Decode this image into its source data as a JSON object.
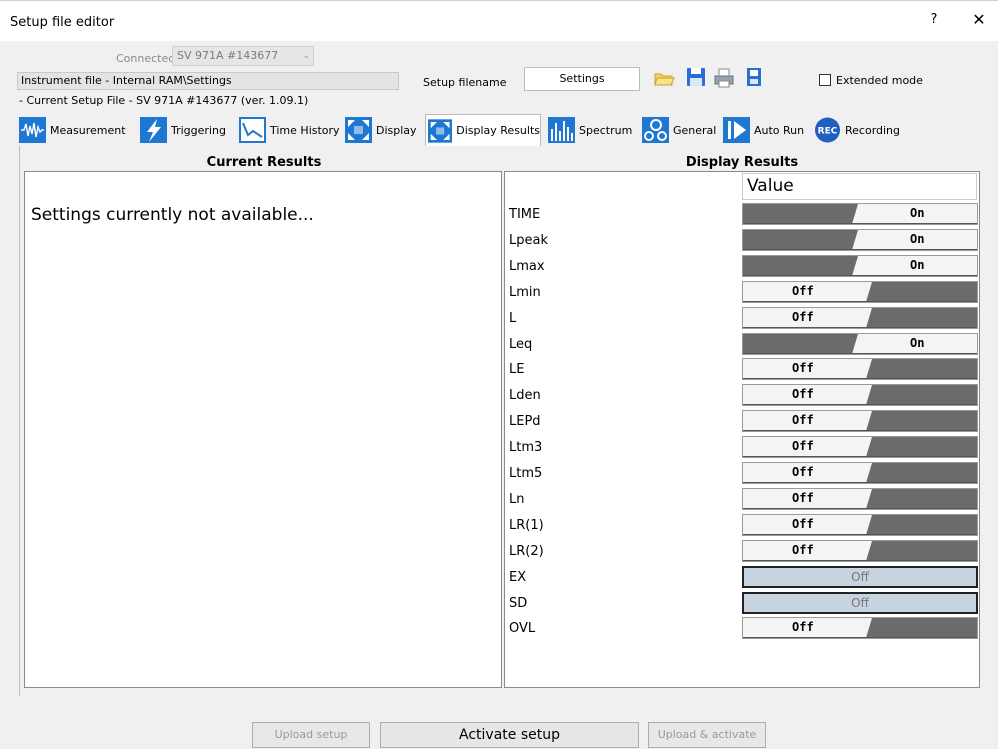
{
  "window": {
    "title": "Setup file editor",
    "help_label": "?",
    "close_label": "✕"
  },
  "header": {
    "connected_label": "Connected",
    "connected_value": "SV 971A #143677",
    "instrument_file": "Instrument file - Internal RAM\\Settings",
    "current_setup": "- Current Setup File  - SV 971A #143677 (ver. 1.09.1)",
    "setup_filename_label": "Setup filename",
    "setup_filename_value": "Settings",
    "extended_mode_label": "Extended mode",
    "extended_mode_checked": false,
    "tool_icons": [
      "open-folder-icon",
      "save-icon",
      "print-icon",
      "save-as-icon"
    ]
  },
  "tabs": [
    {
      "label": "Measurement",
      "icon": "waveform-icon",
      "active": false
    },
    {
      "label": "Triggering",
      "icon": "lightning-icon",
      "active": false
    },
    {
      "label": "Time History",
      "icon": "time-history-icon",
      "active": false
    },
    {
      "label": "Display",
      "icon": "display-icon",
      "active": false
    },
    {
      "label": "Display Results",
      "icon": "display-results-icon",
      "active": true
    },
    {
      "label": "Spectrum",
      "icon": "spectrum-icon",
      "active": false
    },
    {
      "label": "General",
      "icon": "gears-icon",
      "active": false
    },
    {
      "label": "Auto Run",
      "icon": "auto-run-icon",
      "active": false
    },
    {
      "label": "Recording",
      "icon": "rec-icon",
      "active": false
    }
  ],
  "current_results": {
    "heading": "Current Results",
    "message": "Settings currently not available..."
  },
  "display_results": {
    "heading": "Display Results",
    "value_header": "Value",
    "rows": [
      {
        "label": "TIME",
        "value": "On",
        "enabled": true
      },
      {
        "label": "Lpeak",
        "value": "On",
        "enabled": true
      },
      {
        "label": "Lmax",
        "value": "On",
        "enabled": true
      },
      {
        "label": "Lmin",
        "value": "Off",
        "enabled": true
      },
      {
        "label": "L",
        "value": "Off",
        "enabled": true
      },
      {
        "label": "Leq",
        "value": "On",
        "enabled": true
      },
      {
        "label": "LE",
        "value": "Off",
        "enabled": true
      },
      {
        "label": "Lden",
        "value": "Off",
        "enabled": true
      },
      {
        "label": "LEPd",
        "value": "Off",
        "enabled": true
      },
      {
        "label": "Ltm3",
        "value": "Off",
        "enabled": true
      },
      {
        "label": "Ltm5",
        "value": "Off",
        "enabled": true
      },
      {
        "label": "Ln",
        "value": "Off",
        "enabled": true
      },
      {
        "label": "LR(1)",
        "value": "Off",
        "enabled": true
      },
      {
        "label": "LR(2)",
        "value": "Off",
        "enabled": true
      },
      {
        "label": "EX",
        "value": "Off",
        "enabled": false
      },
      {
        "label": "SD",
        "value": "Off",
        "enabled": false
      },
      {
        "label": "OVL",
        "value": "Off",
        "enabled": true
      }
    ]
  },
  "buttons": {
    "upload_setup": "Upload setup",
    "activate_setup": "Activate setup",
    "upload_activate": "Upload & activate"
  },
  "colors": {
    "toggle_dark": "#6b6b6b",
    "toggle_light": "#f4f4f4",
    "disabled_fill": "#c7d4e0",
    "tab_icon_blue": "#1e78d2"
  }
}
